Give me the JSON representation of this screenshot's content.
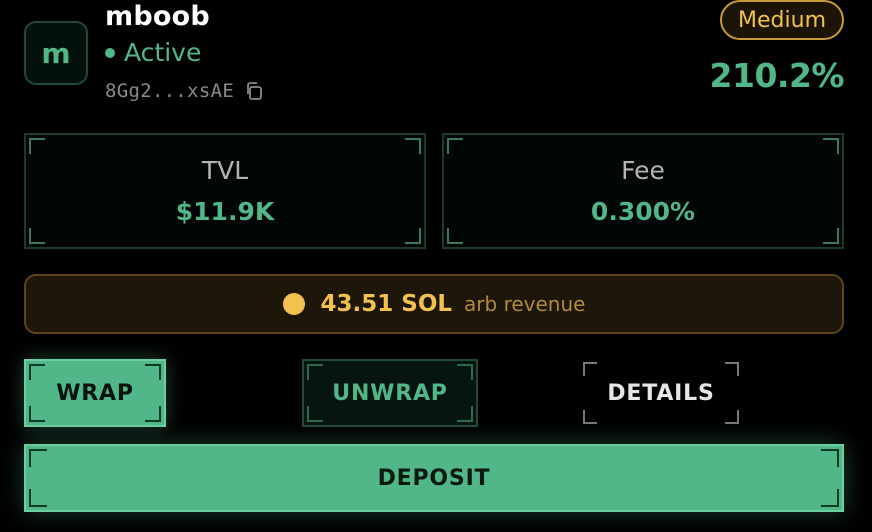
{
  "pool": {
    "avatar_letter": "m",
    "name": "mboob",
    "status": "Active",
    "address": "8Gg2...xsAE",
    "risk": "Medium",
    "apy": "210.2%"
  },
  "stats": {
    "tvl_label": "TVL",
    "tvl_value": "$11.9K",
    "fee_label": "Fee",
    "fee_value": "0.300%"
  },
  "revenue": {
    "amount": "43.51 SOL",
    "label": "arb revenue"
  },
  "actions": {
    "wrap": "WRAP",
    "unwrap": "UNWRAP",
    "details": "DETAILS",
    "deposit": "DEPOSIT"
  },
  "colors": {
    "accent_green": "#52b788",
    "gold": "#f2c14e",
    "background": "#000000"
  },
  "icons": {
    "copy": "copy-icon"
  }
}
